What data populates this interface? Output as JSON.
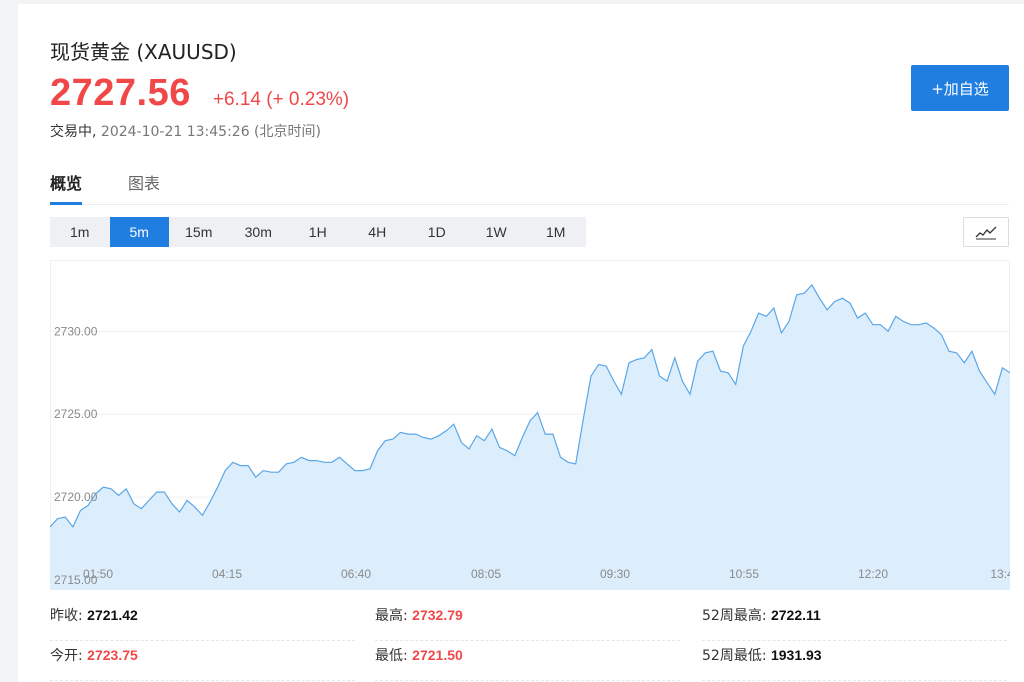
{
  "header": {
    "title": "现货黄金 (XAUUSD)",
    "price": "2727.56",
    "change": "+6.14 (+ 0.23%)",
    "status": "交易中,",
    "timestamp": "2024-10-21 13:45:26 (北京时间)",
    "add_button": "+加自选"
  },
  "tabs": [
    {
      "label": "概览",
      "active": true
    },
    {
      "label": "图表",
      "active": false
    }
  ],
  "intervals": [
    {
      "label": "1m",
      "active": false
    },
    {
      "label": "5m",
      "active": true
    },
    {
      "label": "15m",
      "active": false
    },
    {
      "label": "30m",
      "active": false
    },
    {
      "label": "1H",
      "active": false
    },
    {
      "label": "4H",
      "active": false
    },
    {
      "label": "1D",
      "active": false
    },
    {
      "label": "1W",
      "active": false
    },
    {
      "label": "1M",
      "active": false
    }
  ],
  "chart_type_icon": "line-chart-icon",
  "colors": {
    "accent": "#1f7ee0",
    "up": "#f04848",
    "line": "#5aa6e8",
    "area": "#dceefc"
  },
  "chart_data": {
    "type": "area",
    "x_tick_labels": [
      "01:50",
      "04:15",
      "06:40",
      "08:05",
      "09:30",
      "10:55",
      "12:20",
      "13:4"
    ],
    "y_tick_labels": [
      "2715.00",
      "2720.00",
      "2725.00",
      "2730.00"
    ],
    "ylim": [
      2715,
      2734
    ],
    "grid": true,
    "values": [
      2718.2,
      2718.7,
      2718.8,
      2718.2,
      2719.2,
      2719.5,
      2720.2,
      2720.6,
      2720.5,
      2720.1,
      2720.5,
      2719.6,
      2719.3,
      2719.8,
      2720.3,
      2720.3,
      2719.6,
      2719.1,
      2719.8,
      2719.4,
      2718.9,
      2719.7,
      2720.6,
      2721.6,
      2722.1,
      2721.9,
      2721.9,
      2721.2,
      2721.6,
      2721.5,
      2721.5,
      2722.0,
      2722.1,
      2722.4,
      2722.2,
      2722.2,
      2722.1,
      2722.1,
      2722.4,
      2722.0,
      2721.6,
      2721.6,
      2721.7,
      2722.8,
      2723.4,
      2723.5,
      2723.9,
      2723.8,
      2723.8,
      2723.6,
      2723.5,
      2723.7,
      2724.0,
      2724.4,
      2723.3,
      2722.9,
      2723.7,
      2723.4,
      2724.1,
      2723.0,
      2722.8,
      2722.5,
      2723.6,
      2724.6,
      2725.1,
      2723.8,
      2723.8,
      2722.4,
      2722.1,
      2722.0,
      2724.7,
      2727.3,
      2728.0,
      2727.9,
      2727.0,
      2726.2,
      2728.1,
      2728.3,
      2728.4,
      2728.9,
      2727.3,
      2727.0,
      2728.4,
      2727.0,
      2726.2,
      2728.2,
      2728.7,
      2728.8,
      2727.6,
      2727.5,
      2726.8,
      2729.1,
      2730.0,
      2731.1,
      2730.9,
      2731.4,
      2729.9,
      2730.6,
      2732.2,
      2732.3,
      2732.8,
      2732.0,
      2731.3,
      2731.8,
      2732.0,
      2731.7,
      2730.8,
      2731.1,
      2730.4,
      2730.4,
      2730.0,
      2730.9,
      2730.6,
      2730.4,
      2730.4,
      2730.5,
      2730.2,
      2729.8,
      2728.8,
      2728.7,
      2728.1,
      2728.8,
      2727.6,
      2726.9,
      2726.2,
      2727.8,
      2727.5
    ]
  },
  "stats": {
    "prev_close_label": "昨收:",
    "prev_close": "2721.42",
    "high_label": "最高:",
    "high": "2732.79",
    "week52_high_label": "52周最高:",
    "week52_high": "2722.11",
    "open_label": "今开:",
    "open": "2723.75",
    "low_label": "最低:",
    "low": "2721.50",
    "week52_low_label": "52周最低:",
    "week52_low": "1931.93"
  }
}
